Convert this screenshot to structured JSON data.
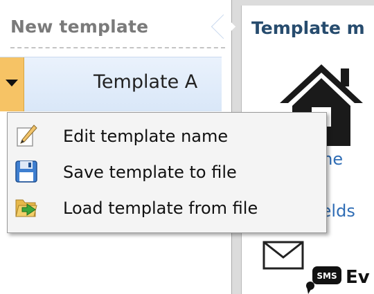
{
  "left_panel": {
    "title": "New template",
    "template_row": {
      "name": "Template A"
    }
  },
  "context_menu": {
    "items": [
      {
        "label": "Edit template name",
        "icon": "pencil-icon"
      },
      {
        "label": "Save template to file",
        "icon": "floppy-disk-icon"
      },
      {
        "label": "Load template from file",
        "icon": "folder-open-icon"
      }
    ]
  },
  "right_panel": {
    "title": "Template m",
    "label_1": "me",
    "label_2": "ields",
    "label_3": "Ev",
    "sms_badge": "SMS",
    "icons": [
      "house-icon",
      "envelope-icon",
      "sms-icon"
    ]
  },
  "colors": {
    "accent_orange": "#f6c365",
    "row_blue": "#d9e7f8",
    "title_blue": "#274c6e",
    "link_blue": "#2f6db5"
  }
}
